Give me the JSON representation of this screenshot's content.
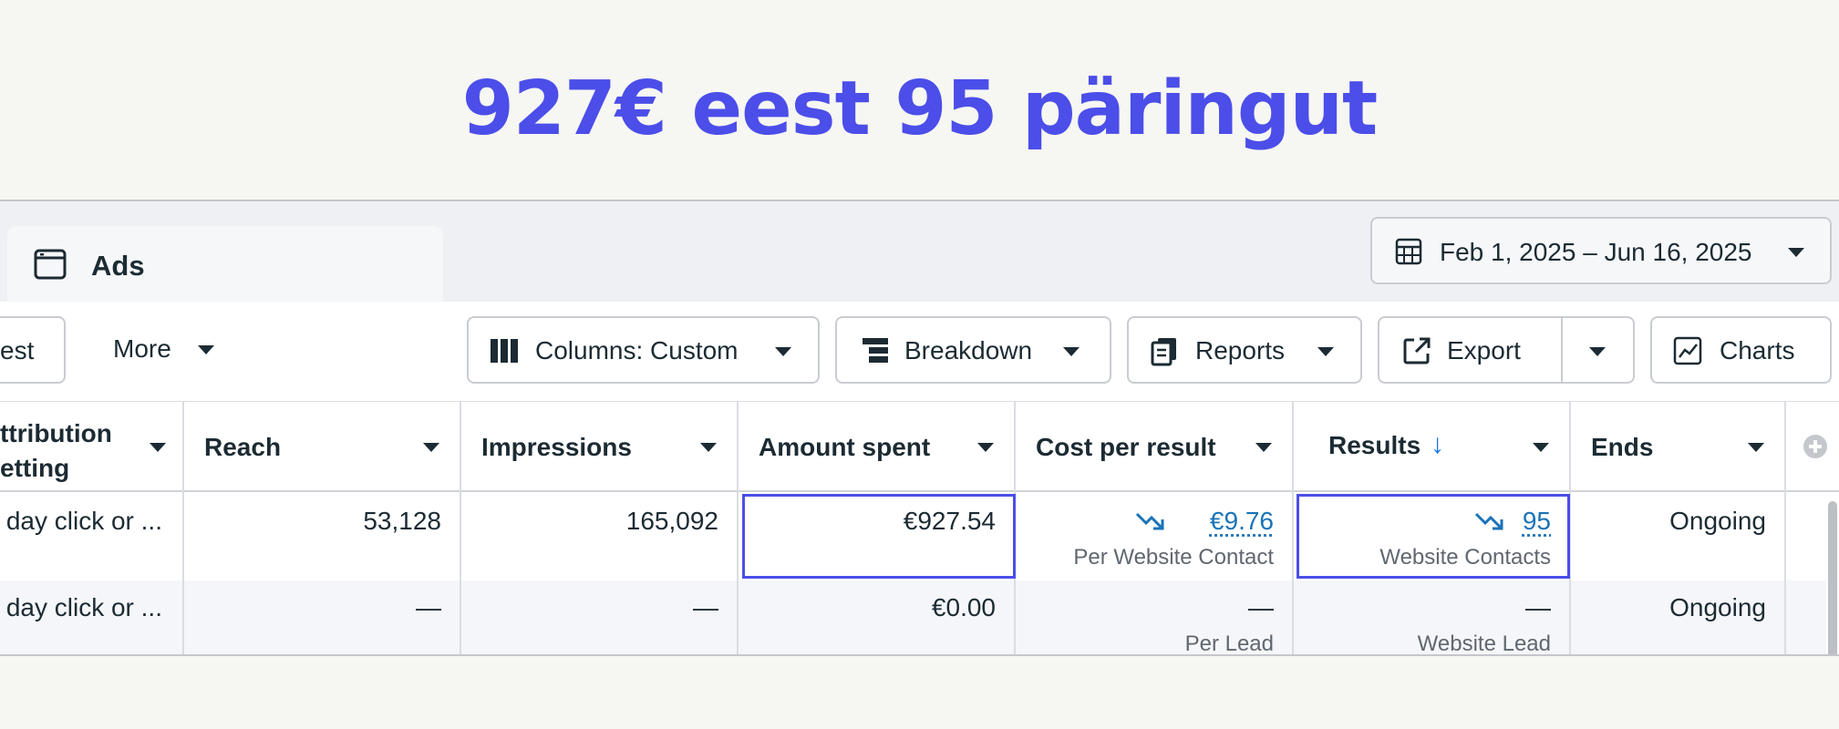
{
  "headline": "927€ eest 95 päringut",
  "tab": {
    "label": "Ads",
    "icon": "window-icon"
  },
  "date_range": {
    "label": "Feb 1, 2025 – Jun 16, 2025",
    "icon": "calendar-icon"
  },
  "toolbar": {
    "test_label": "est",
    "more_label": "More",
    "columns_label": "Columns: Custom",
    "breakdown_label": "Breakdown",
    "reports_label": "Reports",
    "export_label": "Export",
    "charts_label": "Charts"
  },
  "table": {
    "headers": {
      "attribution_line1": "ttribution",
      "attribution_line2": "etting",
      "reach": "Reach",
      "impressions": "Impressions",
      "amount_spent": "Amount spent",
      "cost_per_result": "Cost per result",
      "results": "Results",
      "results_sort": "↓",
      "ends": "Ends"
    },
    "rows": [
      {
        "attribution": "day click or ...",
        "reach": "53,128",
        "impressions": "165,092",
        "amount_spent": "€927.54",
        "cost_per_result": "€9.76",
        "cost_per_result_sub": "Per Website Contact",
        "results": "95",
        "results_sub": "Website Contacts",
        "ends": "Ongoing"
      },
      {
        "attribution": "day click or ...",
        "reach": "—",
        "impressions": "—",
        "amount_spent": "€0.00",
        "cost_per_result": "—",
        "cost_per_result_sub": "Per Lead",
        "results": "—",
        "results_sub": "Website Lead",
        "ends": "Ongoing"
      }
    ]
  },
  "colors": {
    "headline": "#4b4ee8",
    "highlight": "#4b4ee8",
    "link": "#1a73b8"
  }
}
